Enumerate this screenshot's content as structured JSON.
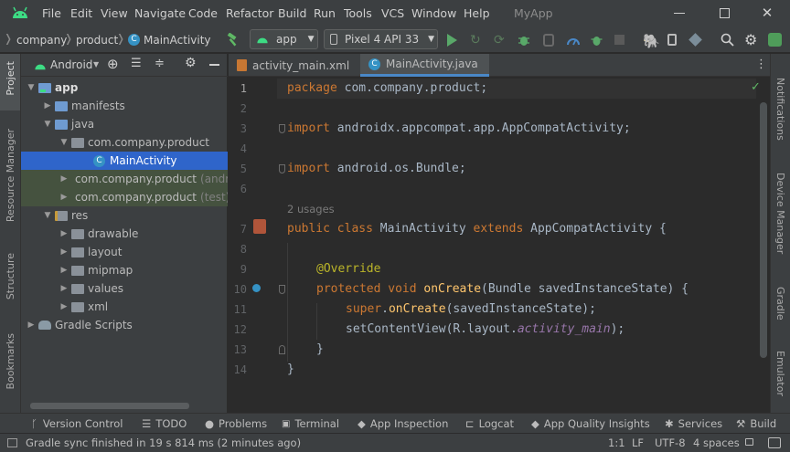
{
  "menubar": {
    "items": [
      "File",
      "Edit",
      "View",
      "Navigate",
      "Code",
      "Refactor",
      "Build",
      "Run",
      "Tools",
      "VCS",
      "Window",
      "Help"
    ],
    "window_title": "MyApp"
  },
  "navbar": {
    "breadcrumbs": [
      "company",
      "product",
      "MainActivity"
    ],
    "run_config": "app",
    "device": "Pixel 4 API 33"
  },
  "left_strip": {
    "project": "Project",
    "resource_manager": "Resource Manager",
    "structure": "Structure",
    "bookmarks": "Bookmarks"
  },
  "right_strip": {
    "notifications": "Notifications",
    "device_manager": "Device Manager",
    "gradle": "Gradle",
    "emulator": "Emulator"
  },
  "project_panel": {
    "view_label": "Android"
  },
  "tree": [
    {
      "label": "app",
      "suffix": "",
      "icon": "module-folder-icon"
    },
    {
      "label": "manifests",
      "suffix": "",
      "icon": "folder-icon"
    },
    {
      "label": "java",
      "suffix": "",
      "icon": "folder-icon"
    },
    {
      "label": "com.company.product",
      "suffix": "",
      "icon": "package-icon"
    },
    {
      "label": "MainActivity",
      "suffix": "",
      "icon": "class-icon"
    },
    {
      "label": "com.company.product",
      "suffix": "(androidTest)",
      "icon": "package-icon"
    },
    {
      "label": "com.company.product",
      "suffix": "(test)",
      "icon": "package-icon"
    },
    {
      "label": "res",
      "suffix": "",
      "icon": "res-folder-icon"
    },
    {
      "label": "drawable",
      "suffix": "",
      "icon": "folder-icon"
    },
    {
      "label": "layout",
      "suffix": "",
      "icon": "folder-icon"
    },
    {
      "label": "mipmap",
      "suffix": "",
      "icon": "folder-icon"
    },
    {
      "label": "values",
      "suffix": "",
      "icon": "folder-icon"
    },
    {
      "label": "xml",
      "suffix": "",
      "icon": "folder-icon"
    },
    {
      "label": "Gradle Scripts",
      "suffix": "",
      "icon": "gradle-icon"
    }
  ],
  "editor": {
    "tabs": [
      "activity_main.xml",
      "MainActivity.java"
    ],
    "line_numbers": [
      "1",
      "2",
      "3",
      "4",
      "5",
      "6",
      "7",
      "8",
      "9",
      "10",
      "11",
      "12",
      "13",
      "14"
    ],
    "usages_hint": "2 usages",
    "code": {
      "l1_kw": "package",
      "l1_rest": " com.company.product;",
      "l3_kw": "import",
      "l3_rest": " androidx.appcompat.app.AppCompatActivity;",
      "l5_kw": "import",
      "l5_rest": " android.os.Bundle;",
      "l7_kw1": "public class",
      "l7_name": " MainActivity ",
      "l7_kw2": "extends",
      "l7_rest": " AppCompatActivity {",
      "l9_ann": "@Override",
      "l10_kw": "protected void",
      "l10_fn": "onCreate",
      "l10_rest": "(Bundle savedInstanceState) {",
      "l11_sup": "super",
      "l11_dot": ".",
      "l11_fn": "onCreate",
      "l11_rest": "(savedInstanceState);",
      "l12_a": "setContentView(R.layout.",
      "l12_it": "activity_main",
      "l12_b": ");",
      "l13": "}",
      "l14": "}"
    }
  },
  "bottom_tools": [
    "Version Control",
    "TODO",
    "Problems",
    "Terminal",
    "App Inspection",
    "Logcat",
    "App Quality Insights",
    "Services",
    "Build"
  ],
  "status": {
    "message": "Gradle sync finished in 19 s 814 ms (2 minutes ago)",
    "position": "1:1",
    "line_sep": "LF",
    "encoding": "UTF-8",
    "indent": "4 spaces"
  },
  "colors": {
    "android_green": "#3ddc84",
    "selection": "#2f65ca",
    "accent_blue": "#4a88c7",
    "keyword": "#cc7832",
    "function": "#ffc66d"
  }
}
